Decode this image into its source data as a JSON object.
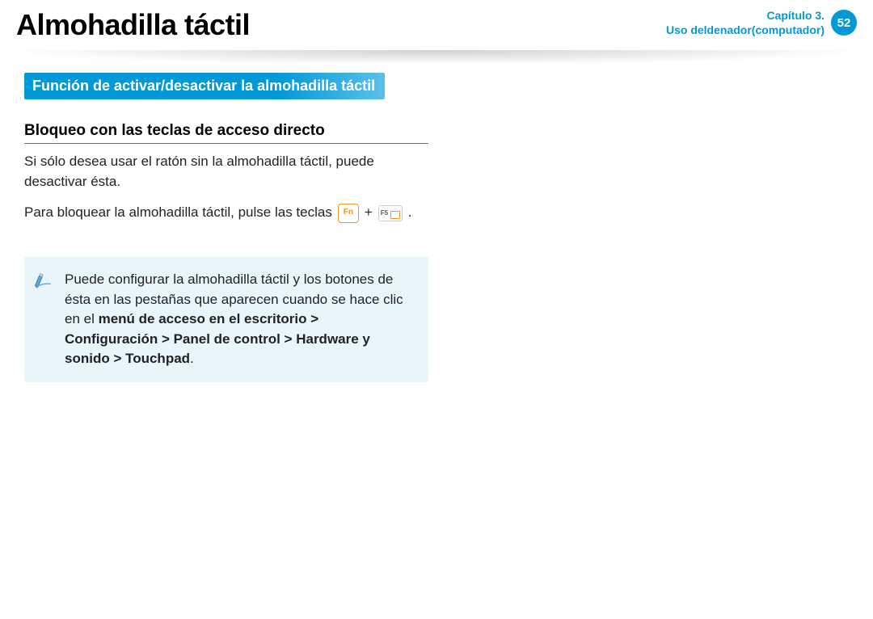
{
  "header": {
    "title": "Almohadilla táctil",
    "chapter_label": "Capítulo 3.",
    "chapter_sub": "Uso deldenador(computador)",
    "page_number": "52"
  },
  "section": {
    "banner": "Función de activar/desactivar la almohadilla táctil",
    "sub_heading": "Bloqueo con las teclas de acceso directo",
    "paragraph1": "Si sólo desea usar el ratón sin la almohadilla táctil, puede desactivar ésta.",
    "paragraph2_pre": "Para bloquear la almohadilla táctil, pulse las teclas",
    "key_fn": "Fn",
    "plus": "+",
    "key_f5": "F5",
    "paragraph2_post": "."
  },
  "note": {
    "text_pre": "Puede configurar la almohadilla táctil y los botones de ésta en las pestañas que aparecen cuando se hace clic en el ",
    "bold_path": "menú de acceso en el escritorio > Configuración > Panel de control > Hardware y sonido  > Touchpad",
    "text_post": "."
  }
}
